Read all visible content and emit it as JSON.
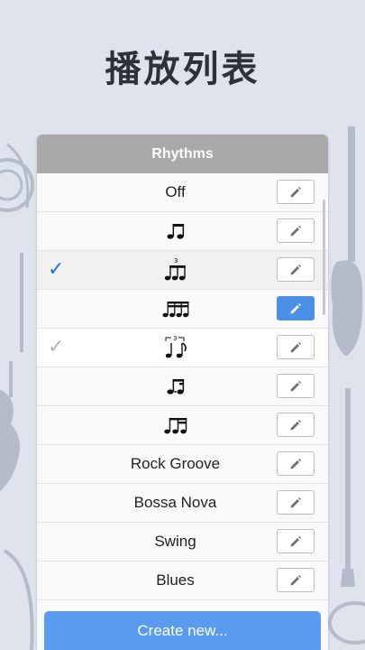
{
  "page": {
    "title": "播放列表"
  },
  "panel": {
    "header": "Rhythms"
  },
  "colors": {
    "accent": "#4a90e6",
    "check_selected": "#1a73e8",
    "check_other": "#b5b5b5"
  },
  "rows": [
    {
      "label": "Off",
      "glyph": "",
      "check": "",
      "edit_active": false
    },
    {
      "label": "",
      "glyph": "eighth-notes",
      "check": "",
      "edit_active": false
    },
    {
      "label": "",
      "glyph": "triplet-eighths",
      "check": "✓",
      "check_state": "selected",
      "edit_active": false
    },
    {
      "label": "",
      "glyph": "sixteenth-notes",
      "check": "",
      "edit_active": true
    },
    {
      "label": "",
      "glyph": "swing-triplet",
      "check": "✓",
      "check_state": "other",
      "edit_active": false
    },
    {
      "label": "",
      "glyph": "dotted-eighth-sixteenth",
      "check": "",
      "edit_active": false
    },
    {
      "label": "",
      "glyph": "eighth-two-sixteenths",
      "check": "",
      "edit_active": false
    },
    {
      "label": "Rock Groove",
      "glyph": "",
      "check": "",
      "edit_active": false
    },
    {
      "label": "Bossa Nova",
      "glyph": "",
      "check": "",
      "edit_active": false
    },
    {
      "label": "Swing",
      "glyph": "",
      "check": "",
      "edit_active": false
    },
    {
      "label": "Blues",
      "glyph": "",
      "check": "",
      "edit_active": false
    }
  ],
  "actions": {
    "create_label": "Create new..."
  }
}
